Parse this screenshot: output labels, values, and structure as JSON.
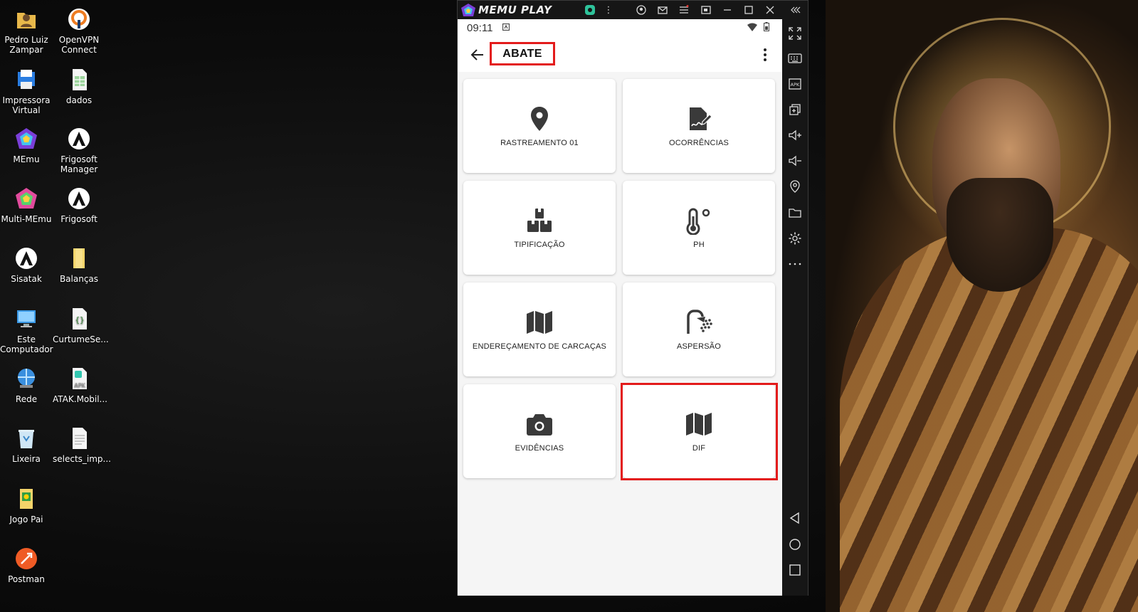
{
  "desktop": {
    "icons": [
      {
        "label": "Pedro Luiz Zampar",
        "icon": "user-folder-icon"
      },
      {
        "label": "OpenVPN Connect",
        "icon": "openvpn-icon"
      },
      {
        "label": "Impressora Virtual",
        "icon": "printer-icon"
      },
      {
        "label": "dados",
        "icon": "spreadsheet-icon"
      },
      {
        "label": "MEmu",
        "icon": "memu-icon"
      },
      {
        "label": "Frigosoft Manager",
        "icon": "frigosoft-icon"
      },
      {
        "label": "Multi-MEmu",
        "icon": "multi-memu-icon"
      },
      {
        "label": "Frigosoft",
        "icon": "frigosoft-icon"
      },
      {
        "label": "Sisatak",
        "icon": "sisatak-icon"
      },
      {
        "label": "Balanças",
        "icon": "folder-icon"
      },
      {
        "label": "Este Computador",
        "icon": "computer-icon"
      },
      {
        "label": "CurtumeSe...",
        "icon": "json-file-icon"
      },
      {
        "label": "Rede",
        "icon": "network-icon"
      },
      {
        "label": "ATAK.Mobil...",
        "icon": "apk-file-icon"
      },
      {
        "label": "Lixeira",
        "icon": "recycle-bin-icon"
      },
      {
        "label": "selects_imp...",
        "icon": "text-file-icon"
      },
      {
        "label": "Jogo Pai",
        "icon": "folder-icon"
      },
      {
        "label": "Postman",
        "icon": "postman-icon"
      }
    ]
  },
  "emulator": {
    "logo_text": "MEMU PLAY",
    "phone": {
      "status_time": "09:11",
      "appbar_title": "ABATE",
      "tiles": [
        {
          "label": "RASTREAMENTO 01",
          "icon": "location-pin-icon"
        },
        {
          "label": "OCORRÊNCIAS",
          "icon": "signature-document-icon"
        },
        {
          "label": "TIPIFICAÇÃO",
          "icon": "boxes-icon"
        },
        {
          "label": "PH",
          "icon": "thermometer-icon"
        },
        {
          "label": "ENDEREÇAMENTO DE CARCAÇAS",
          "icon": "map-icon"
        },
        {
          "label": "ASPERSÃO",
          "icon": "shower-icon"
        },
        {
          "label": "EVIDÊNCIAS",
          "icon": "camera-icon"
        },
        {
          "label": "DIF",
          "icon": "map-icon"
        }
      ]
    },
    "sidebar_icons": [
      "collapse-icon",
      "fullscreen-icon",
      "keyboard-icon",
      "apk-icon",
      "multi-window-icon",
      "volume-up-icon",
      "volume-down-icon",
      "location-icon",
      "folder-icon",
      "settings-icon",
      "more-icon",
      "back-nav-icon",
      "home-nav-icon",
      "recents-nav-icon"
    ]
  },
  "colors": {
    "highlight": "#e31b1b",
    "icon": "#3a3a3a"
  }
}
